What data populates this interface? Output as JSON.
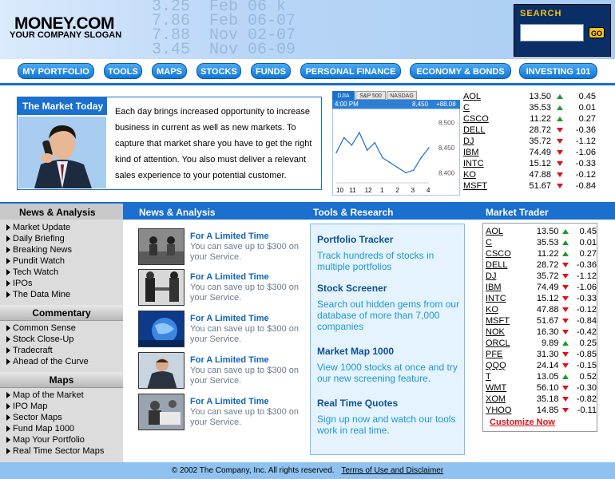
{
  "header": {
    "logo": "MONEY.COM",
    "slogan": "YOUR COMPANY SLOGAN",
    "bg_numbers": "3.25  Feb 06 k\n7.86  Feb 06-07\n7.88  Nov 02-07\n3.45  Nov 06-09",
    "search_label": "SEARCH",
    "search_placeholder": "",
    "go_label": "GO"
  },
  "nav": [
    "MY PORTFOLIO",
    "TOOLS",
    "MAPS",
    "STOCKS",
    "FUNDS",
    "PERSONAL FINANCE",
    "ECONOMY & BONDS",
    "INVESTING 101"
  ],
  "market_today": {
    "title": "The Market Today",
    "text": "Each day brings increased opportunity to increase business in current as well as new markets. To capture that market share you have to get the right kind of attention. You also must deliver a relevant sales experience to your potential customer."
  },
  "chart": {
    "tabs": [
      "DJIA",
      "S&P 500",
      "NASDAG"
    ],
    "time": "4:00 PM",
    "value": "8,450",
    "change": "+88.08",
    "ylabels": [
      "8,500",
      "8,450",
      "8,400"
    ],
    "xlabels": [
      "10",
      "11",
      "12",
      "1",
      "2",
      "3",
      "4"
    ]
  },
  "chart_data": {
    "type": "line",
    "title": "",
    "x": [
      10,
      10.5,
      11,
      11.5,
      12,
      12.5,
      13,
      13.5,
      14,
      14.5,
      15,
      15.5,
      16
    ],
    "values": [
      8440,
      8470,
      8455,
      8480,
      8445,
      8460,
      8430,
      8420,
      8410,
      8400,
      8405,
      8430,
      8450
    ],
    "xlabel": "",
    "ylabel": "",
    "ylim": [
      8380,
      8520
    ],
    "grid": false
  },
  "quotes_top": [
    {
      "sym": "AOL",
      "price": "13.50",
      "dir": "up",
      "chg": "0.45"
    },
    {
      "sym": "C",
      "price": "35.53",
      "dir": "up",
      "chg": "0.01"
    },
    {
      "sym": "CSCO",
      "price": "11.22",
      "dir": "up",
      "chg": "0.27"
    },
    {
      "sym": "DELL",
      "price": "28.72",
      "dir": "down",
      "chg": "-0.36"
    },
    {
      "sym": "DJ",
      "price": "35.72",
      "dir": "down",
      "chg": "-1.12"
    },
    {
      "sym": "IBM",
      "price": "74.49",
      "dir": "down",
      "chg": "-1.06"
    },
    {
      "sym": "INTC",
      "price": "15.12",
      "dir": "down",
      "chg": "-0.33"
    },
    {
      "sym": "KO",
      "price": "47.88",
      "dir": "down",
      "chg": "-0.12"
    },
    {
      "sym": "MSFT",
      "price": "51.67",
      "dir": "down",
      "chg": "-0.84"
    }
  ],
  "section_bar": {
    "left": "News & Analysis",
    "news": "News & Analysis",
    "tools": "Tools & Research",
    "trader": "Market Trader"
  },
  "sidebar": {
    "groups": [
      {
        "head": "Commentary",
        "items": [
          "Common Sense",
          "Stock Close-Up",
          "Tradecraft",
          "Ahead of the Curve"
        ]
      },
      {
        "head": "Maps",
        "items": [
          "Map of the Market",
          "IPO Map",
          "Sector Maps",
          "Fund Map 1000",
          "Map Your Portfolio",
          "Real Time Sector Maps"
        ]
      }
    ],
    "news_items": [
      "Market Update",
      "Daily Briefing",
      "Breaking News",
      "Pundit Watch",
      "Tech Watch",
      "IPOs",
      "The Data Mine"
    ]
  },
  "news": [
    {
      "title": "For A Limited Time",
      "desc": "You can save up to $300 on your Service."
    },
    {
      "title": "For A Limited Time",
      "desc": "You can save up to $300 on your Service."
    },
    {
      "title": "For A Limited Time",
      "desc": "You can save up to $300 on your Service."
    },
    {
      "title": "For A Limited Time",
      "desc": "You can save up to $300 on your Service."
    },
    {
      "title": "For A Limited Time",
      "desc": "You can save up to $300 on your Service."
    }
  ],
  "tools": [
    {
      "title": "Portfolio Tracker",
      "desc": "Track hundreds of stocks in multiple portfolios"
    },
    {
      "title": "Stock Screener",
      "desc": "Search out hidden gems from our database of more than 7,000 companies"
    },
    {
      "title": "Market Map 1000",
      "desc": "View 1000 stocks at once and try our new screening feature."
    },
    {
      "title": "Real Time Quotes",
      "desc": "Sign up now and watch our tools work in real time."
    }
  ],
  "trader": [
    {
      "sym": "AOL",
      "price": "13.50",
      "dir": "up",
      "chg": "0.45"
    },
    {
      "sym": "C",
      "price": "35.53",
      "dir": "up",
      "chg": "0.01"
    },
    {
      "sym": "CSCO",
      "price": "11.22",
      "dir": "up",
      "chg": "0.27"
    },
    {
      "sym": "DELL",
      "price": "28.72",
      "dir": "down",
      "chg": "-0.36"
    },
    {
      "sym": "DJ",
      "price": "35.72",
      "dir": "down",
      "chg": "-1.12"
    },
    {
      "sym": "IBM",
      "price": "74.49",
      "dir": "down",
      "chg": "-1.06"
    },
    {
      "sym": "INTC",
      "price": "15.12",
      "dir": "down",
      "chg": "-0.33"
    },
    {
      "sym": "KO",
      "price": "47.88",
      "dir": "down",
      "chg": "-0.12"
    },
    {
      "sym": "MSFT",
      "price": "51.67",
      "dir": "down",
      "chg": "-0.84"
    },
    {
      "sym": "NOK",
      "price": "16.30",
      "dir": "down",
      "chg": "-0.42"
    },
    {
      "sym": "ORCL",
      "price": "9.89",
      "dir": "up",
      "chg": "0.25"
    },
    {
      "sym": "PFE",
      "price": "31.30",
      "dir": "down",
      "chg": "-0.85"
    },
    {
      "sym": "QQQ",
      "price": "24.14",
      "dir": "down",
      "chg": "-0.15"
    },
    {
      "sym": "T",
      "price": "13.05",
      "dir": "up",
      "chg": "0.52"
    },
    {
      "sym": "WMT",
      "price": "56.10",
      "dir": "down",
      "chg": "-0.30"
    },
    {
      "sym": "XOM",
      "price": "35.18",
      "dir": "down",
      "chg": "-0.82"
    },
    {
      "sym": "YHOO",
      "price": "14.85",
      "dir": "down",
      "chg": "-0.11"
    }
  ],
  "customize": "Customize Now",
  "footer": {
    "copyright": "© 2002 The Company, Inc. All rights reserved.",
    "link": "Terms of Use and Disclaimer"
  },
  "colors": {
    "accent": "#1a6fcf",
    "up": "#1a9a2a",
    "down": "#d8141a",
    "search_bg": "#0a2e66",
    "search_label": "#f6c11a"
  }
}
